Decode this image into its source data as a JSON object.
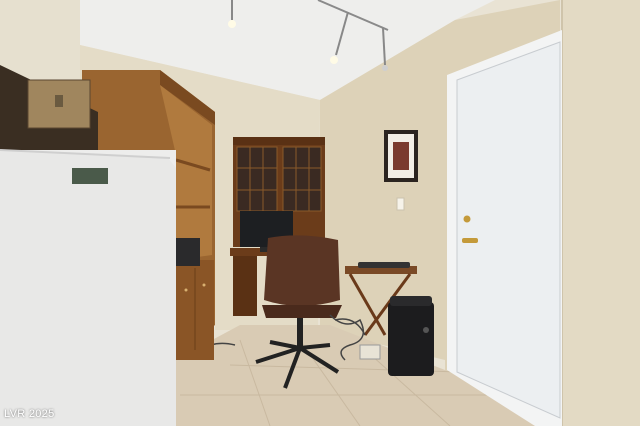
{
  "photo": {
    "watermark": "LVR 2025"
  },
  "colors": {
    "ceiling": "#eeeeec",
    "wall": "#e4dcc7",
    "wall_shadow": "#d9cfb6",
    "floor": "#d9cbb4",
    "door": "#eceff1",
    "cabinet_wood": "#8a5a26",
    "fridge": "#ededec"
  }
}
